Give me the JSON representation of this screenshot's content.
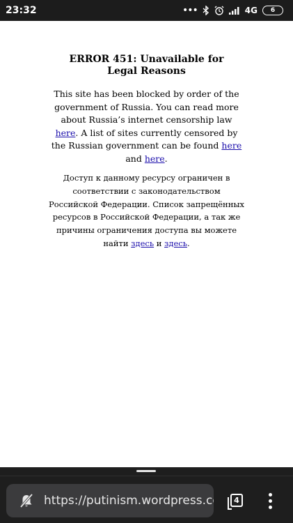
{
  "status_bar": {
    "time": "23:32",
    "network": "4G",
    "battery": "6",
    "icons": [
      "more-dots-icon",
      "bluetooth-icon",
      "alarm-icon",
      "signal-icon",
      "battery-icon"
    ]
  },
  "page": {
    "title": "ERROR 451: Unavailable for Legal Reasons",
    "english": {
      "text_1": "This site has been blocked by order of the government of Russia. You can read more about Russia’s internet censorship law ",
      "link_1": "here",
      "text_2": ". A list of sites currently censored by the Russian government can be found ",
      "link_2": "here",
      "text_3": " and ",
      "link_3": "here",
      "text_4": "."
    },
    "russian": {
      "text_1": "Доступ к данному ресурсу ограничен в соответствии с законодательством Российской Федерации. Список запрещённых ресурсов в Российской Федерации, а так же причины ограничения доступа вы можете найти ",
      "link_1": "здесь",
      "text_2": " и ",
      "link_2": "здесь",
      "text_3": "."
    },
    "link_color": "#1a0dab"
  },
  "browser": {
    "url": "https://putinism.wordpress.com",
    "tab_count": "4",
    "site_icon": "no-notifications-icon",
    "menu_icon": "more-vert-icon"
  }
}
